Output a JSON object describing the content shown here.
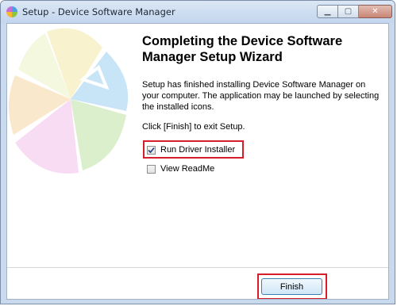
{
  "window": {
    "title": "Setup - Device Software Manager"
  },
  "wizard": {
    "heading": "Completing the Device Software Manager Setup Wizard",
    "paragraph1": "Setup has finished installing Device Software Manager on your computer. The application may be launched by selecting the installed icons.",
    "paragraph2": "Click [Finish] to exit Setup."
  },
  "options": [
    {
      "label": "Run Driver Installer",
      "checked": true
    },
    {
      "label": "View ReadMe",
      "checked": false
    }
  ],
  "buttons": {
    "finish_label": "Finish"
  },
  "colors": {
    "highlight": "#d61d2a",
    "titlebar": "#c9daee"
  }
}
